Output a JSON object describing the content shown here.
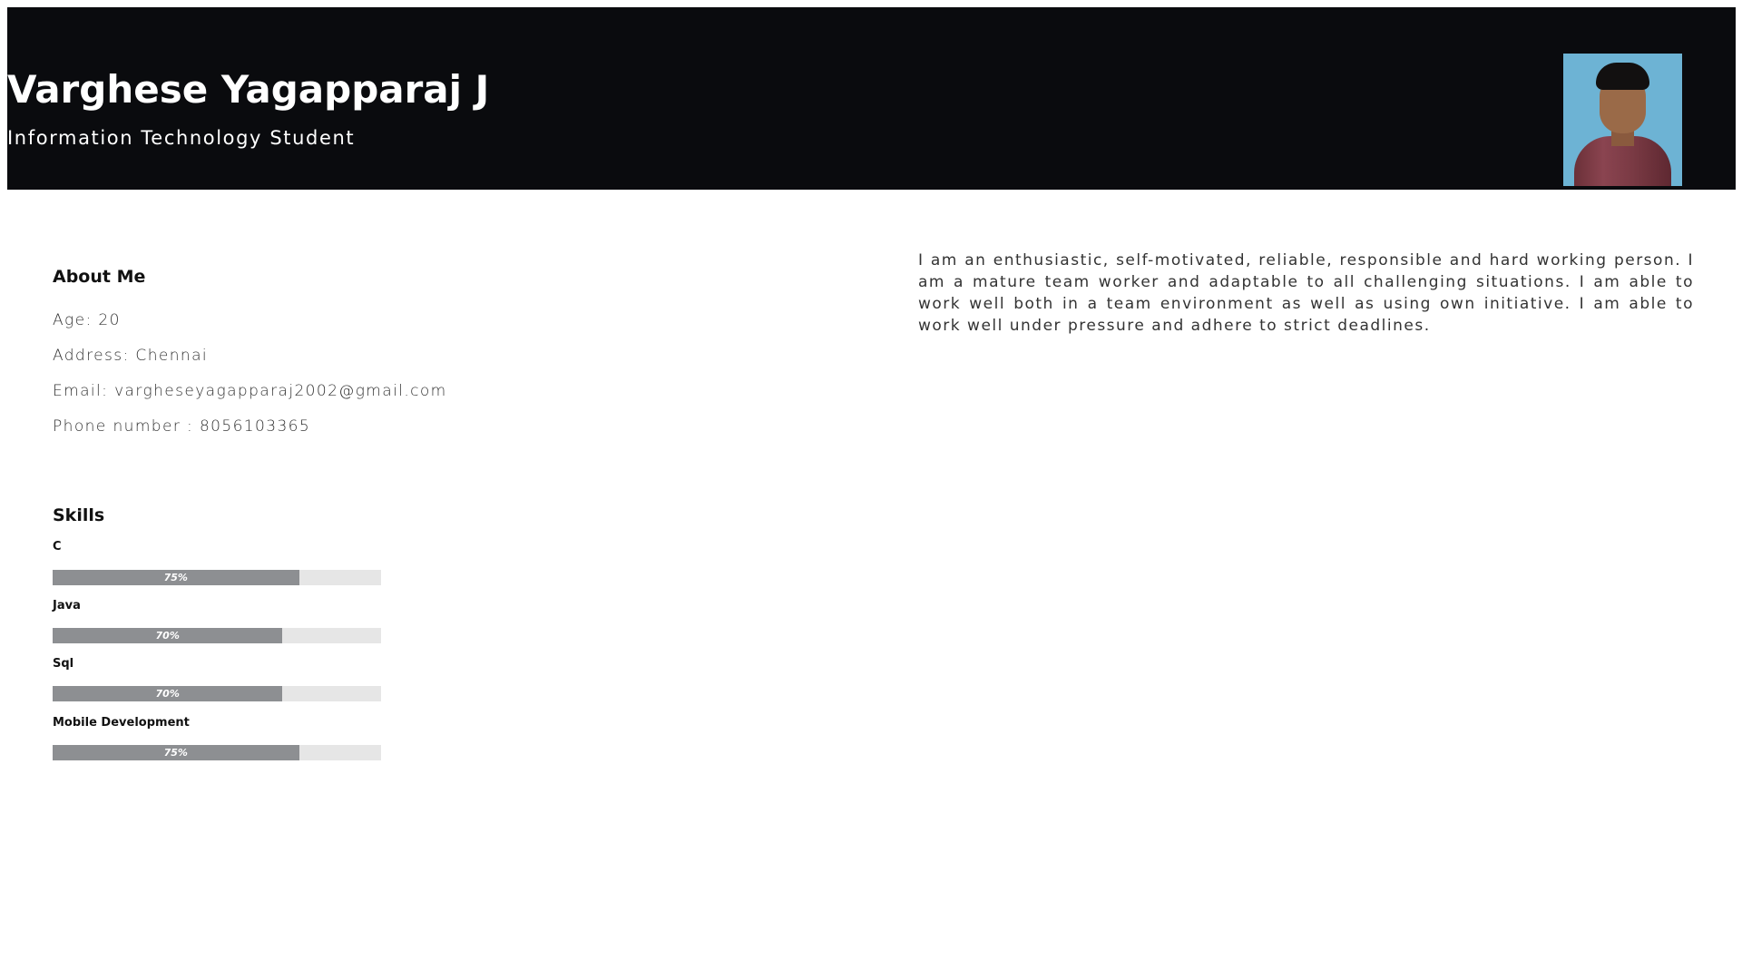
{
  "header": {
    "name": "Varghese Yagapparaj J",
    "role": "Information Technology Student",
    "background_color": "#0a0b0e"
  },
  "about": {
    "title": "About Me",
    "age": "Age: 20",
    "address": "Address: Chennai",
    "email": "Email: vargheseyagapparaj2002@gmail.com",
    "phone": "Phone number : 8056103365"
  },
  "bio": "I am an enthusiastic, self-motivated, reliable, responsible and hard working person. I am a mature team worker and adaptable to all challenging situations. I am able to work well both in a team environment as well as using own initiative. I am able to work well under pressure and adhere to strict deadlines.",
  "skills": {
    "title": "Skills",
    "items": [
      {
        "name": "C",
        "level": 75,
        "label": "75%"
      },
      {
        "name": "Java",
        "level": 70,
        "label": "70%"
      },
      {
        "name": "Sql",
        "level": 70,
        "label": "70%"
      },
      {
        "name": "Mobile Development",
        "level": 75,
        "label": "75%"
      }
    ],
    "bar_fill_color": "#8d8f92",
    "bar_track_color": "#e6e6e6"
  }
}
